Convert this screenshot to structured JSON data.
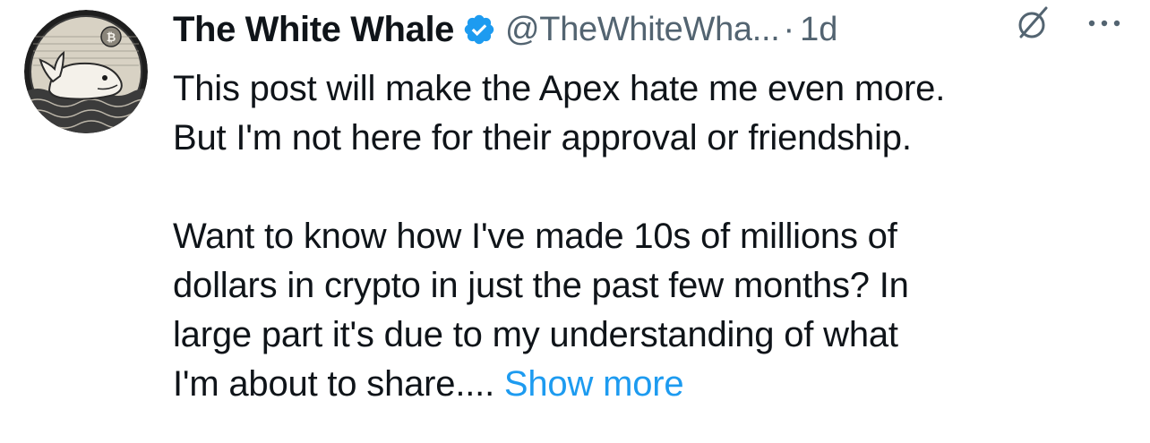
{
  "author": {
    "display_name": "The White Whale",
    "handle": "@TheWhiteWha...",
    "verified": true,
    "verified_color": "#1d9bf0"
  },
  "meta": {
    "separator": "·",
    "timestamp": "1d"
  },
  "icons": {
    "avatar": "whale-avatar",
    "badge": "verified-badge-icon",
    "grok": "grok-icon",
    "more": "more-options-icon"
  },
  "post": {
    "paragraph_1": "This post will make the Apex hate me even more.\nBut I'm not here for their approval or friendship.",
    "paragraph_2": "Want to know how I've made 10s of millions of\ndollars in crypto in just the past few months? In\nlarge part it's due to my understanding of what\nI'm about to share....",
    "show_more": "Show more",
    "link_color": "#1d9bf0"
  }
}
